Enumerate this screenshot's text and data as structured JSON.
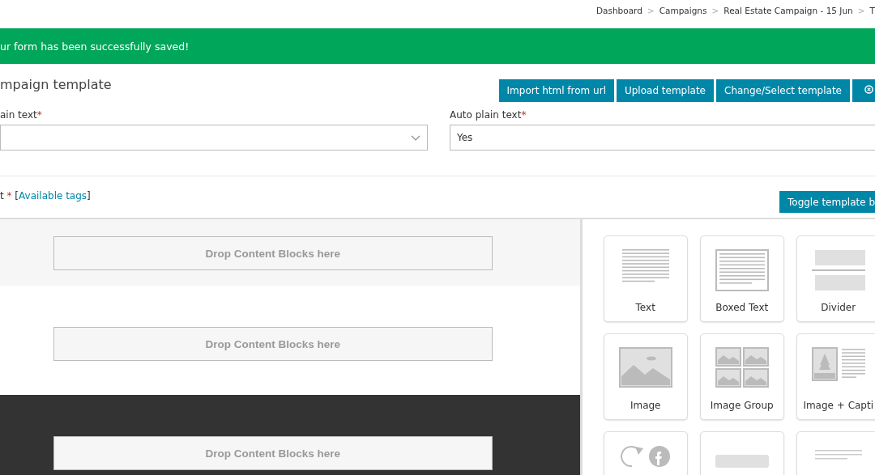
{
  "breadcrumb": [
    {
      "label": "Dashboard"
    },
    {
      "separator": ">",
      "label": "Campaigns"
    },
    {
      "separator": ">",
      "label": "Real Estate Campaign - 15 Jun"
    },
    {
      "separator": ">",
      "label": "T"
    }
  ],
  "alert": {
    "message": "ur form has been successfully saved!"
  },
  "section_title": "mpaign template",
  "buttons": [
    {
      "label": "Import html from url",
      "kind": "text"
    },
    {
      "label": "Upload template",
      "kind": "text"
    },
    {
      "label": "Change/Select template",
      "kind": "text"
    },
    {
      "kind": "close"
    }
  ],
  "fields": [
    {
      "label": "ain text",
      "required_mark": "*",
      "kind": "select"
    },
    {
      "label": "Auto plain text",
      "required_mark": "*",
      "kind": "text",
      "value": "Yes"
    }
  ],
  "content_label": {
    "label": "t",
    "required_mark": "*",
    "open": "[",
    "link": "Available tags",
    "close": "]"
  },
  "toggle_button": "Toggle template b",
  "canvas_rows": [
    {
      "kind": "light",
      "placeholder": "Drop Content Blocks here"
    },
    {
      "kind": "white",
      "placeholder": "Drop Content Blocks here"
    },
    {
      "kind": "dark",
      "placeholder": "Drop Content Blocks here"
    }
  ],
  "blocks": [
    {
      "kind": "text",
      "label": "Text"
    },
    {
      "kind": "boxed",
      "label": "Boxed Text"
    },
    {
      "kind": "divider",
      "label": "Divider"
    },
    {
      "kind": "image",
      "label": "Image"
    },
    {
      "kind": "group",
      "label": "Image Group"
    },
    {
      "kind": "caption",
      "label": "Image + Capti"
    },
    {
      "kind": "social"
    },
    {
      "kind": "button"
    },
    {
      "kind": "footer"
    }
  ]
}
